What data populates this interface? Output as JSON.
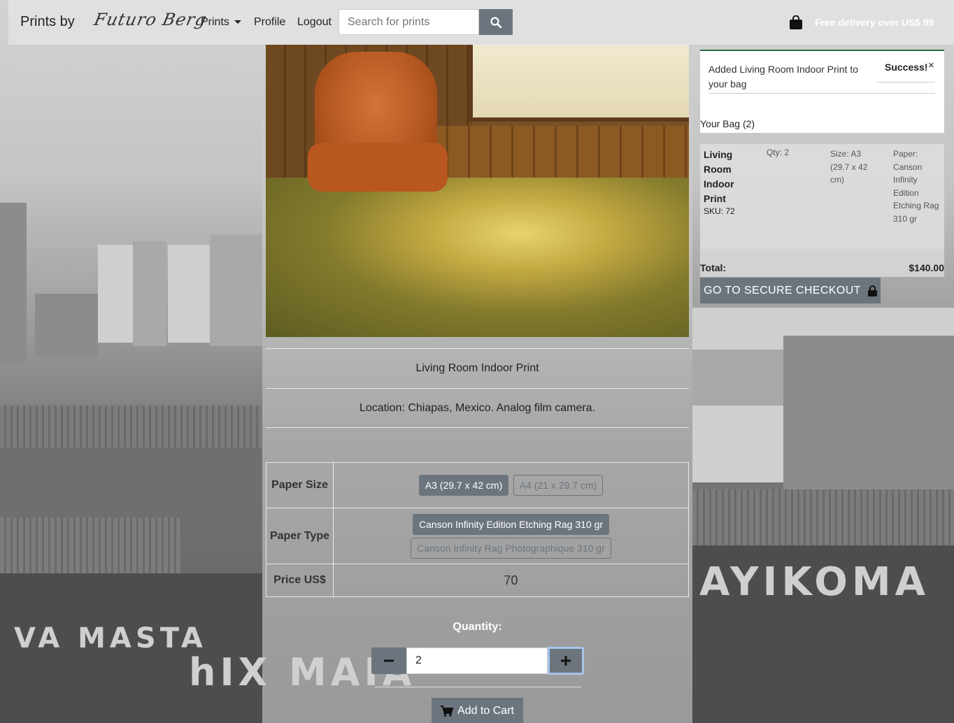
{
  "nav": {
    "brand_text": "Prints by",
    "brand_signature": "Futuro Berg",
    "prints_label": "Prints",
    "profile_label": "Profile",
    "logout_label": "Logout",
    "search_placeholder": "Search for prints",
    "delivery_text": "Free delivery over US$ 99"
  },
  "product": {
    "name": "Living Room Indoor Print",
    "description": "Location: Chiapas, Mexico. Analog film camera.",
    "paper_size_label": "Paper Size",
    "paper_size_options": [
      {
        "label": "A3 (29.7 x 42 cm)",
        "selected": true
      },
      {
        "label": "A4 (21 x 29.7 cm)",
        "selected": false
      }
    ],
    "paper_type_label": "Paper Type",
    "paper_type_options": [
      {
        "label": "Canson Infinity Edition Etching Rag 310 gr",
        "selected": true
      },
      {
        "label": "Canson Infinity Rag Photographique 310 gr",
        "selected": false
      }
    ],
    "price_label": "Price US$",
    "price_value": "70",
    "quantity_label": "Quantity:",
    "quantity_value": "2",
    "add_to_cart_label": "Add to Cart"
  },
  "toast": {
    "message": "Added Living Room Indoor Print to your bag",
    "title": "Success!",
    "close": "×",
    "bag_title": "Your Bag (2)",
    "item": {
      "name": "Living Room Indoor Print",
      "sku": "SKU: 72",
      "qty": "Qty: 2",
      "size": "Size: A3 (29.7 x 42 cm)",
      "paper": "Paper: Canson Infinity Edition Etching Rag 310 gr"
    },
    "total_label": "Total:",
    "total_value": "$140.00",
    "checkout_label": "GO TO SECURE CHECKOUT"
  },
  "background": {
    "graffiti_left": "VA MASTA",
    "graffiti_left2": "hIX MAIA",
    "graffiti_right": "AYIKOMA"
  },
  "colors": {
    "button_gray": "#6c757d",
    "toast_border": "#2b6b46",
    "focus_ring": "#a7c4ec"
  },
  "icons": [
    "search-icon",
    "shopping-bag-icon",
    "minus-icon",
    "plus-icon",
    "cart-icon",
    "lock-icon",
    "close-icon",
    "chevron-down-icon"
  ]
}
